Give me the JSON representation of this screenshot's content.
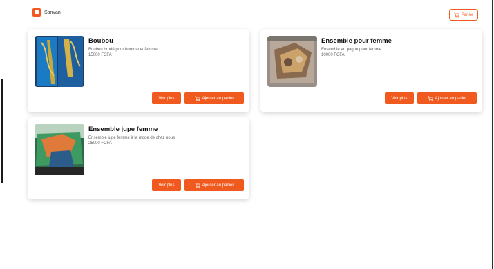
{
  "header": {
    "brand_name": "Sanvan",
    "cart_label": "Panier"
  },
  "products": [
    {
      "title": "Boubou",
      "description": "Boubou brodé pour homme et femme",
      "price": "15000 FCFA",
      "view_label": "Voir plus",
      "add_label": "Ajouter au panier"
    },
    {
      "title": "Ensemble pour femme",
      "description": "Ensemble en pagne pour femme",
      "price": "10000 FCFA",
      "view_label": "Voir plus",
      "add_label": "Ajouter au panier"
    },
    {
      "title": "Ensemble jupe femme",
      "description": "Ensemble jupe femme à la mode de chez nous",
      "price": "25000 FCFA",
      "view_label": "Voir plus",
      "add_label": "Ajouter au panier"
    }
  ],
  "icons": {
    "brand": "store-logo-icon",
    "cart": "cart-icon"
  },
  "colors": {
    "accent": "#f05a1e"
  }
}
